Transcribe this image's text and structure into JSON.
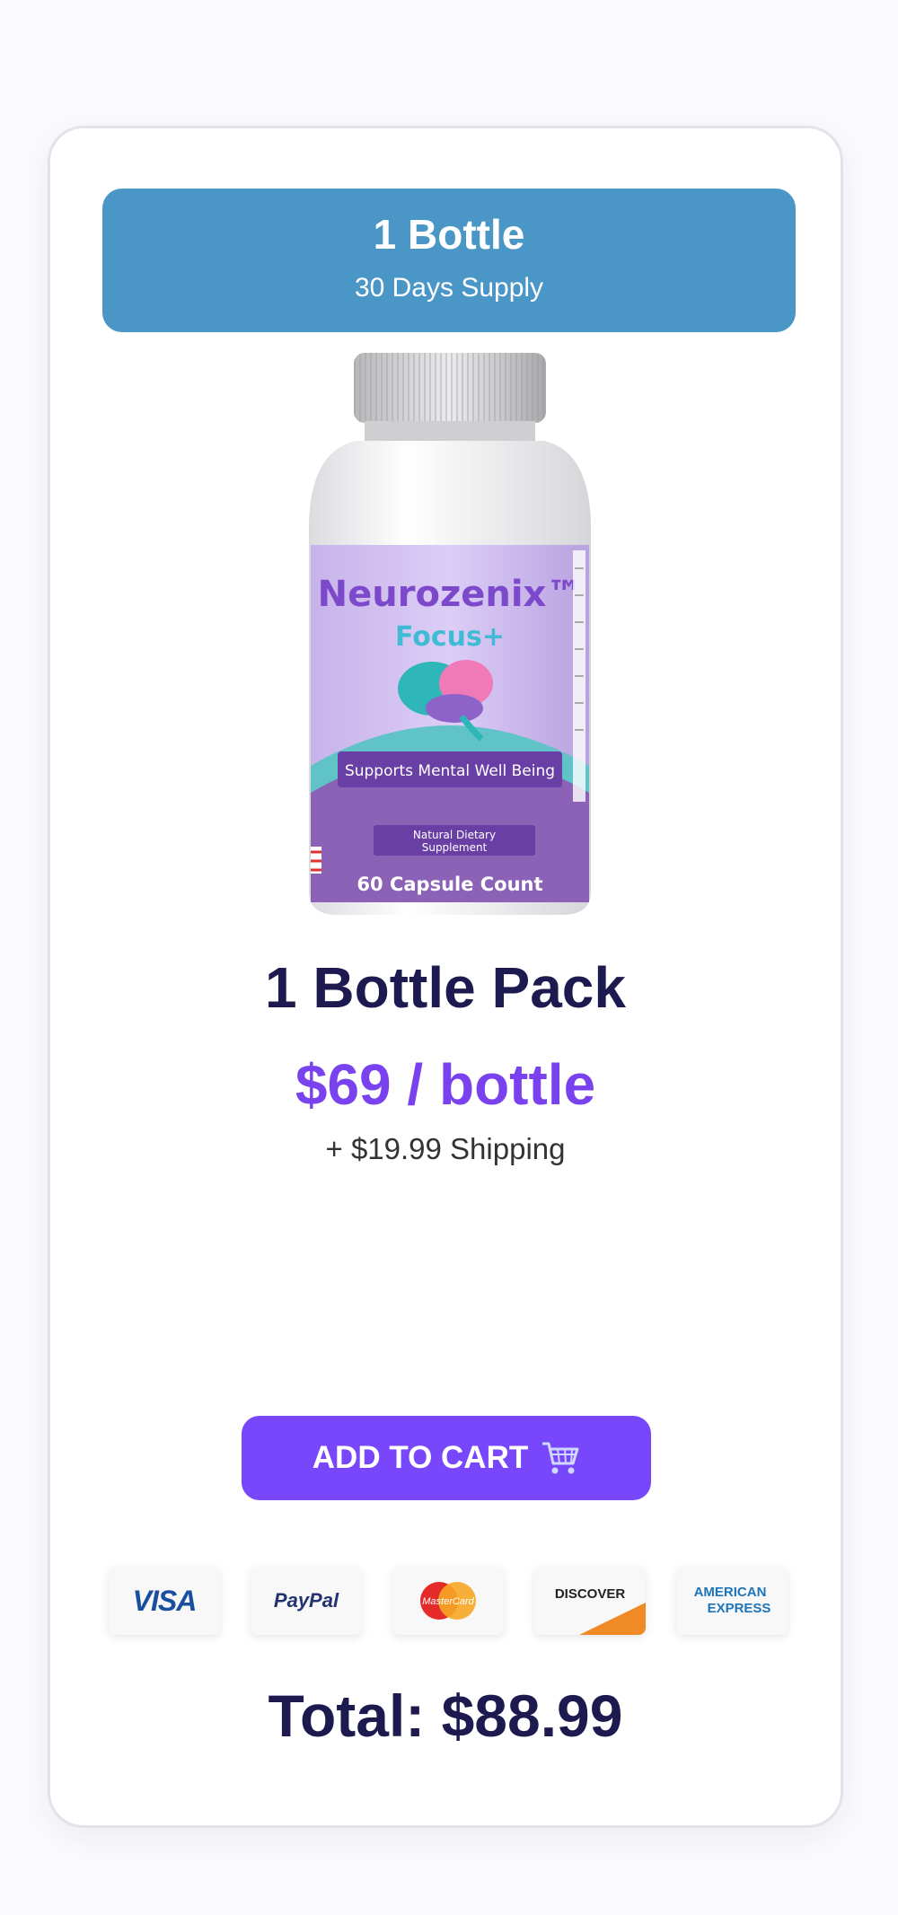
{
  "header": {
    "title": "1 Bottle",
    "subtitle": "30 Days Supply"
  },
  "product": {
    "brand": "Neurozenix™",
    "line": "Focus+",
    "claim": "Supports Mental Well Being",
    "type": "Natural Dietary Supplement",
    "type_line1": "Natural Dietary",
    "type_line2": "Supplement",
    "count": "60 Capsule Count"
  },
  "pack_title": "1 Bottle Pack",
  "price": "$69 / bottle",
  "shipping": "+ $19.99 Shipping",
  "cart_button": {
    "label": "ADD TO CART",
    "icon": "cart-icon"
  },
  "payments": [
    {
      "name": "visa",
      "label": "VISA"
    },
    {
      "name": "paypal",
      "label": "PayPal"
    },
    {
      "name": "mastercard",
      "label": "MasterCard"
    },
    {
      "name": "discover",
      "label": "DISCOVER"
    },
    {
      "name": "amex",
      "label": "AMERICAN EXPRESS",
      "line1": "AMERICAN",
      "line2": "EXPRESS"
    }
  ],
  "total": "Total: $88.99",
  "colors": {
    "header_bg": "#4a97c7",
    "button_bg": "#7846fb",
    "price": "#7a42ee",
    "title": "#1d1a4f",
    "label_purple": "#c9b6ec"
  }
}
